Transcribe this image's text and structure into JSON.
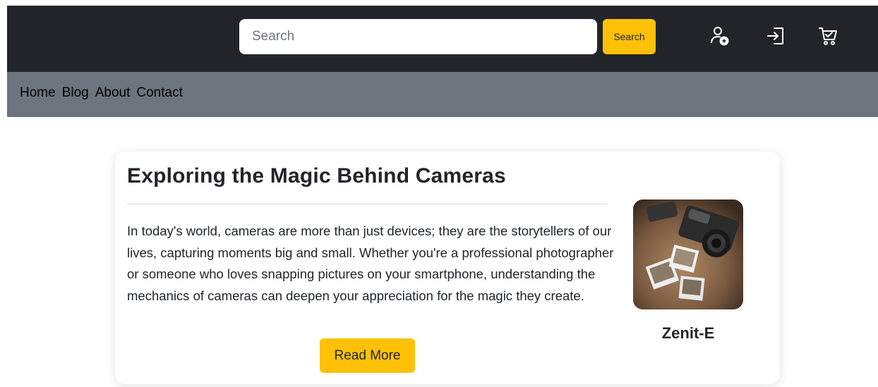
{
  "header": {
    "search": {
      "placeholder": "Search",
      "value": ""
    },
    "search_button_label": "Search",
    "icons": [
      "add-user-icon",
      "login-icon",
      "cart-icon"
    ],
    "colors": {
      "bar": "#212529",
      "accent": "#ffc107"
    }
  },
  "nav": {
    "links": [
      "Home",
      "Blog",
      "About",
      "Contact"
    ],
    "background": "#6c757d"
  },
  "post": {
    "title": "Exploring the Magic Behind Cameras",
    "body": "In today's world, cameras are more than just devices; they are the storytellers of our lives, capturing moments big and small. Whether you're a professional photographer or someone who loves snapping pictures on your smartphone, understanding the mechanics of cameras can deepen your appreciation for the magic they create.",
    "read_more_label": "Read More",
    "author": "Zenit-E"
  }
}
